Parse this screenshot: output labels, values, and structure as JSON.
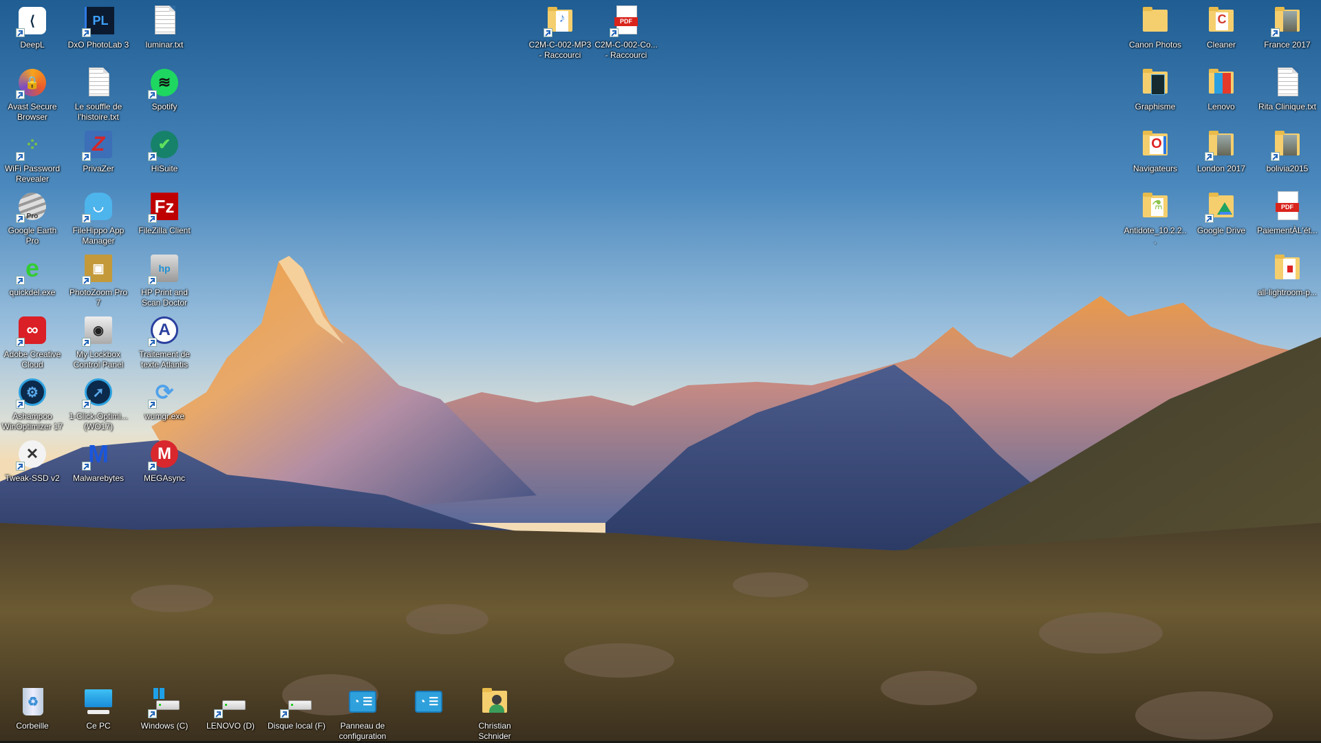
{
  "desktop": {
    "wallpaper": "Alpine landscape at sunrise (Matterhorn)",
    "left_icons": [
      {
        "label": "DeepL",
        "icon": "deepl-icon",
        "type": "app",
        "shortcut": true
      },
      {
        "label": "DxO PhotoLab 3",
        "icon": "dxo-photolab-icon",
        "type": "app",
        "shortcut": true
      },
      {
        "label": "luminar.txt",
        "icon": "text-file-icon",
        "type": "txt",
        "shortcut": false
      },
      {
        "label": "Avast Secure Browser",
        "icon": "avast-browser-icon",
        "type": "app",
        "shortcut": true
      },
      {
        "label": "Le souffle de l'histoire.txt",
        "icon": "text-file-icon",
        "type": "txt",
        "shortcut": false
      },
      {
        "label": "Spotify",
        "icon": "spotify-icon",
        "type": "app",
        "shortcut": true
      },
      {
        "label": "WiFi Password Revealer",
        "icon": "wifi-revealer-icon",
        "type": "app",
        "shortcut": true
      },
      {
        "label": "PrivaZer",
        "icon": "privazer-icon",
        "type": "app",
        "shortcut": true
      },
      {
        "label": "HiSuite",
        "icon": "hisuite-icon",
        "type": "app",
        "shortcut": true
      },
      {
        "label": "Google Earth Pro",
        "icon": "google-earth-icon",
        "type": "app",
        "shortcut": true
      },
      {
        "label": "FileHippo App Manager",
        "icon": "filehippo-icon",
        "type": "app",
        "shortcut": true
      },
      {
        "label": "FileZilla Client",
        "icon": "filezilla-icon",
        "type": "app",
        "shortcut": true
      },
      {
        "label": "quickdel.exe",
        "icon": "quickdel-icon",
        "type": "app",
        "shortcut": true
      },
      {
        "label": "PhotoZoom Pro 7",
        "icon": "photozoom-icon",
        "type": "app",
        "shortcut": true
      },
      {
        "label": "HP Print and Scan Doctor",
        "icon": "hp-doctor-icon",
        "type": "app",
        "shortcut": true
      },
      {
        "label": "Adobe Creative Cloud",
        "icon": "creative-cloud-icon",
        "type": "app",
        "shortcut": true
      },
      {
        "label": "My Lockbox Control Panel",
        "icon": "lockbox-icon",
        "type": "app",
        "shortcut": true
      },
      {
        "label": "Traitement de texte Atlantis",
        "icon": "atlantis-icon",
        "type": "app",
        "shortcut": true
      },
      {
        "label": "Ashampoo WinOptimizer 17",
        "icon": "winoptimizer-icon",
        "type": "app",
        "shortcut": true
      },
      {
        "label": "1-Click-Optimi... (WO17)",
        "icon": "one-click-optimizer-icon",
        "type": "app",
        "shortcut": true
      },
      {
        "label": "wumgr.exe",
        "icon": "wumgr-icon",
        "type": "app",
        "shortcut": true
      },
      {
        "label": "Tweak-SSD v2",
        "icon": "tweak-ssd-icon",
        "type": "app",
        "shortcut": true
      },
      {
        "label": "Malwarebytes",
        "icon": "malwarebytes-icon",
        "type": "app",
        "shortcut": true
      },
      {
        "label": "MEGAsync",
        "icon": "megasync-icon",
        "type": "app",
        "shortcut": true
      }
    ],
    "top_icons": [
      {
        "label": "C2M-C-002-MP3 - Raccourci",
        "icon": "music-folder-icon",
        "type": "folder",
        "shortcut": true
      },
      {
        "label": "C2M-C-002-Co... - Raccourci",
        "icon": "pdf-file-icon",
        "type": "pdf",
        "shortcut": true
      }
    ],
    "right_icons": [
      {
        "label": "Canon Photos",
        "icon": "folder-icon",
        "type": "folder",
        "shortcut": false
      },
      {
        "label": "Cleaner",
        "icon": "ccleaner-folder-icon",
        "type": "folder",
        "shortcut": false
      },
      {
        "label": "France 2017",
        "icon": "photo-folder-icon",
        "type": "folder",
        "shortcut": true
      },
      {
        "label": "Graphisme",
        "icon": "graphisme-folder-icon",
        "type": "folder",
        "shortcut": false
      },
      {
        "label": "Lenovo",
        "icon": "lenovo-folder-icon",
        "type": "folder",
        "shortcut": false
      },
      {
        "label": "Rita Clinique.txt",
        "icon": "text-file-icon",
        "type": "txt",
        "shortcut": false
      },
      {
        "label": "Navigateurs",
        "icon": "browsers-folder-icon",
        "type": "folder",
        "shortcut": false
      },
      {
        "label": "London 2017",
        "icon": "photo-folder-icon",
        "type": "folder",
        "shortcut": true
      },
      {
        "label": "bolivia2015",
        "icon": "photo-folder-icon",
        "type": "folder",
        "shortcut": true
      },
      {
        "label": "Antidote_10.2.2...",
        "icon": "antidote-folder-icon",
        "type": "folder",
        "shortcut": false
      },
      {
        "label": "Google Drive",
        "icon": "google-drive-icon",
        "type": "folder",
        "shortcut": true
      },
      {
        "label": "PaiementÀL'ét...",
        "icon": "pdf-file-icon",
        "type": "pdf",
        "shortcut": false
      },
      {
        "label": "all-lightroom-p...",
        "icon": "pdf-folder-icon",
        "type": "folder",
        "shortcut": false
      }
    ],
    "bottom_icons": [
      {
        "label": "Corbeille",
        "icon": "recycle-bin-icon",
        "type": "system",
        "shortcut": false
      },
      {
        "label": "Ce PC",
        "icon": "computer-icon",
        "type": "system",
        "shortcut": false
      },
      {
        "label": "Windows (C)",
        "icon": "windows-drive-icon",
        "type": "drive",
        "shortcut": true
      },
      {
        "label": "LENOVO (D)",
        "icon": "drive-icon",
        "type": "drive",
        "shortcut": true
      },
      {
        "label": "Disque local (F)",
        "icon": "drive-icon",
        "type": "drive",
        "shortcut": true
      },
      {
        "label": "Panneau de configuration",
        "icon": "control-panel-icon",
        "type": "system",
        "shortcut": false
      },
      {
        "label": "",
        "icon": "control-panel-icon",
        "type": "system",
        "shortcut": false
      },
      {
        "label": "Christian Schnider",
        "icon": "user-folder-icon",
        "type": "folder",
        "shortcut": false
      }
    ]
  }
}
